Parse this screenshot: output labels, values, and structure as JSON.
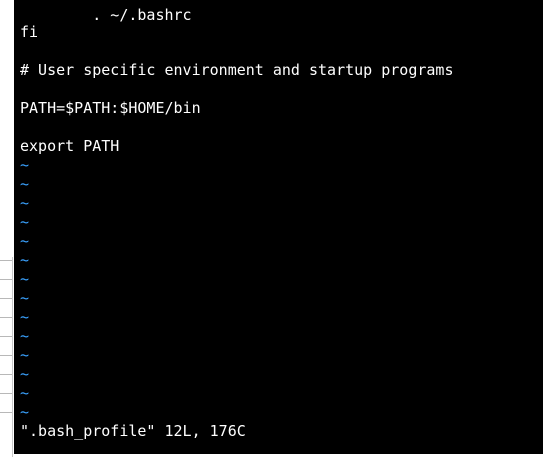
{
  "editor": {
    "lines": [
      "        . ~/.bashrc",
      "fi",
      "",
      "# User specific environment and startup programs",
      "",
      "PATH=$PATH:$HOME/bin",
      "",
      "export PATH"
    ],
    "tilde": "~",
    "status_line": "\".bash_profile\" 12L, 176C"
  },
  "colors": {
    "background": "#000000",
    "text": "#ffffff",
    "tilde": "#3aa2ff"
  }
}
